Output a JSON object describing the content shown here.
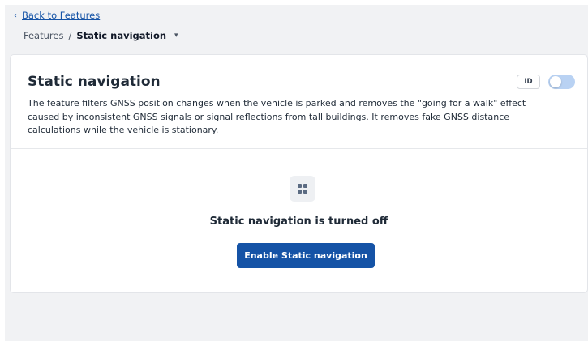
{
  "nav": {
    "back_label": "Back to Features"
  },
  "breadcrumb": {
    "parent": "Features",
    "separator": "/",
    "current": "Static navigation"
  },
  "card": {
    "title": "Static navigation",
    "description": "The feature filters GNSS position changes when the vehicle is parked and removes the \"going for a walk\" effect caused by inconsistent GNSS signals or signal reflections from tall buildings. It removes fake GNSS distance calculations while the vehicle is stationary.",
    "id_badge": "ID",
    "toggle_state": "off"
  },
  "empty_state": {
    "icon": "grid-icon",
    "message": "Static navigation is turned off",
    "button_label": "Enable Static navigation"
  },
  "colors": {
    "primary": "#1553a6",
    "toggle_off": "#b9d2f3",
    "background": "#f1f2f4"
  }
}
